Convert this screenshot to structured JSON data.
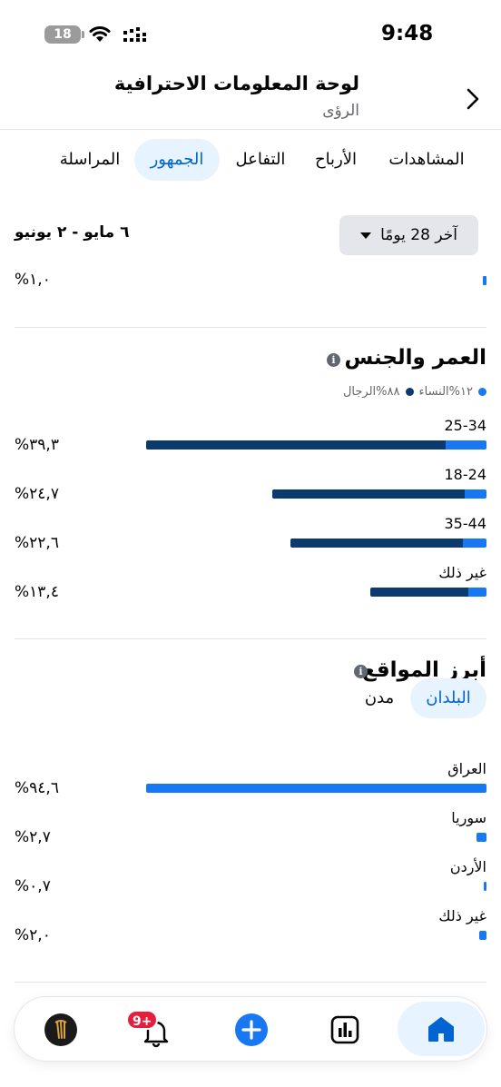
{
  "status_bar": {
    "time": "9:48",
    "battery": "18"
  },
  "header": {
    "title": "لوحة المعلومات الاحترافية",
    "subtitle": "الرؤى"
  },
  "tabs": [
    {
      "label": "المشاهدات",
      "active": false
    },
    {
      "label": "الأرباح",
      "active": false
    },
    {
      "label": "التفاعل",
      "active": false
    },
    {
      "label": "الجمهور",
      "active": true
    },
    {
      "label": "المراسلة",
      "active": false
    }
  ],
  "date_filter": {
    "selected": "آخر 28 يومًا",
    "range_text": "٦ مايو - ٢ يونيو"
  },
  "top_partial": {
    "percent_text": "١,٠%",
    "fraction": 0.01
  },
  "age_gender": {
    "title": "العمر والجنس",
    "legend_women": "١٢%النساء",
    "legend_men": "٨٨%الرجال",
    "women_color": "#1877f2",
    "men_color": "#0b3a6e",
    "rows": [
      {
        "label": "25-34",
        "percent_text": "٣٩,٣%",
        "value": 39.3,
        "women_share": 0.12
      },
      {
        "label": "18-24",
        "percent_text": "٢٤,٧%",
        "value": 24.7,
        "women_share": 0.1
      },
      {
        "label": "35-44",
        "percent_text": "٢٢,٦%",
        "value": 22.6,
        "women_share": 0.12
      },
      {
        "label": "غير ذلك",
        "percent_text": "١٣,٤%",
        "value": 13.4,
        "women_share": 0.16
      }
    ]
  },
  "top_locations": {
    "title": "أبرز المواقع",
    "toggle_countries": "البلدان",
    "toggle_cities": "مدن",
    "bar_color": "#1877f2",
    "rows": [
      {
        "label": "العراق",
        "percent_text": "٩٤,٦%",
        "value": 94.6
      },
      {
        "label": "سوريا",
        "percent_text": "٢,٧%",
        "value": 2.7
      },
      {
        "label": "الأردن",
        "percent_text": "٠,٧%",
        "value": 0.7
      },
      {
        "label": "غير ذلك",
        "percent_text": "٢,٠%",
        "value": 2.0
      }
    ]
  },
  "bottom_nav": {
    "notifications_badge": "9+"
  },
  "icons": [
    "wifi-icon",
    "signal-icon",
    "back-chevron-icon",
    "caret-down-icon",
    "info-icon",
    "home-icon",
    "insights-icon",
    "plus-icon",
    "bell-icon"
  ]
}
